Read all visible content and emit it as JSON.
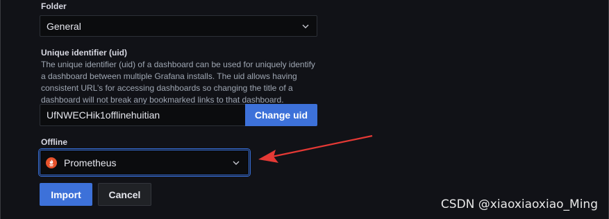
{
  "folder": {
    "label": "Folder",
    "selected": "General"
  },
  "uid": {
    "label": "Unique identifier (uid)",
    "description": "The unique identifier (uid) of a dashboard can be used for uniquely identify a dashboard between multiple Grafana installs. The uid allows having consistent URL’s for accessing dashboards so changing the title of a dashboard will not break any bookmarked links to that dashboard.",
    "value": "UfNWECHik1offlinehuitian",
    "change_button": "Change uid"
  },
  "datasource": {
    "label": "Offline",
    "selected": "Prometheus",
    "icon": "prometheus-icon"
  },
  "actions": {
    "import_label": "Import",
    "cancel_label": "Cancel"
  },
  "annotation": {
    "arrow_color": "#e53935"
  },
  "watermark": "CSDN @xiaoxiaoxiao_Ming",
  "colors": {
    "background": "#111217",
    "primary": "#3d71d9",
    "focus": "#3871dc"
  }
}
